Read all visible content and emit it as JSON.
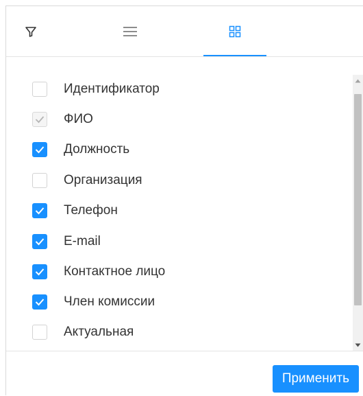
{
  "tabs": [
    {
      "icon": "filter-icon",
      "active": false
    },
    {
      "icon": "menu-icon",
      "active": false
    },
    {
      "icon": "grid-icon",
      "active": true
    }
  ],
  "columns": [
    {
      "label": "Идентификатор",
      "checked": false,
      "disabled": false
    },
    {
      "label": "ФИО",
      "checked": true,
      "disabled": true
    },
    {
      "label": "Должность",
      "checked": true,
      "disabled": false
    },
    {
      "label": "Организация",
      "checked": false,
      "disabled": false
    },
    {
      "label": "Телефон",
      "checked": true,
      "disabled": false
    },
    {
      "label": "E-mail",
      "checked": true,
      "disabled": false
    },
    {
      "label": "Контактное лицо",
      "checked": true,
      "disabled": false
    },
    {
      "label": "Член комиссии",
      "checked": true,
      "disabled": false
    },
    {
      "label": "Актуальная",
      "checked": false,
      "disabled": false
    }
  ],
  "footer": {
    "apply_label": "Применить"
  },
  "colors": {
    "accent": "#1890ff",
    "text": "#333333",
    "border": "#d9d9d9"
  }
}
